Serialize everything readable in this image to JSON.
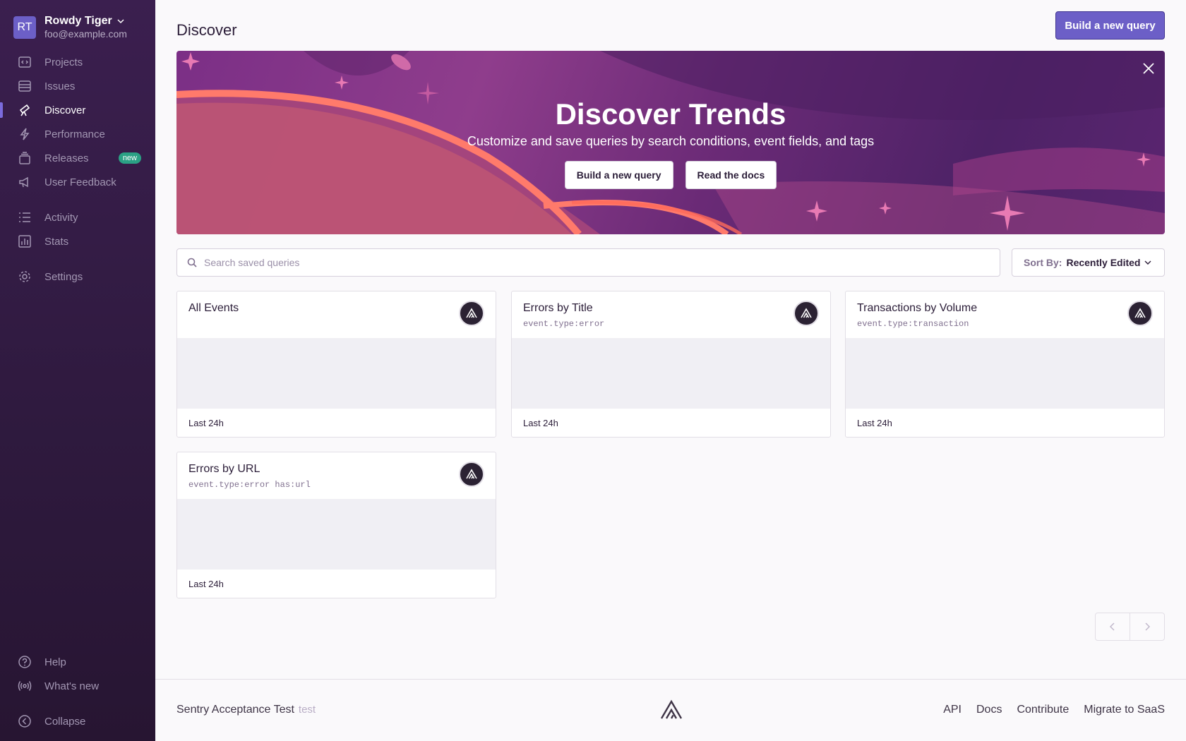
{
  "org": {
    "initials": "RT",
    "name": "Rowdy Tiger",
    "email": "foo@example.com"
  },
  "nav": {
    "projects": "Projects",
    "issues": "Issues",
    "discover": "Discover",
    "performance": "Performance",
    "releases": "Releases",
    "releases_badge": "new",
    "user_feedback": "User Feedback",
    "activity": "Activity",
    "stats": "Stats",
    "settings": "Settings",
    "help": "Help",
    "whats_new": "What's new",
    "collapse": "Collapse"
  },
  "header": {
    "title": "Discover",
    "build_button": "Build a new query"
  },
  "banner": {
    "title": "Discover Trends",
    "subtitle": "Customize and save queries by search conditions, event fields, and tags",
    "build_button": "Build a new query",
    "docs_button": "Read the docs"
  },
  "search": {
    "placeholder": "Search saved queries",
    "value": ""
  },
  "sort": {
    "label": "Sort By:",
    "value": "Recently Edited"
  },
  "cards": [
    {
      "title": "All Events",
      "query": "",
      "footer": "Last 24h"
    },
    {
      "title": "Errors by Title",
      "query": "event.type:error",
      "footer": "Last 24h"
    },
    {
      "title": "Transactions by Volume",
      "query": "event.type:transaction",
      "footer": "Last 24h"
    },
    {
      "title": "Errors by URL",
      "query": "event.type:error has:url",
      "footer": "Last 24h"
    }
  ],
  "footer": {
    "name": "Sentry Acceptance Test",
    "tag": "test",
    "links": {
      "api": "API",
      "docs": "Docs",
      "contribute": "Contribute",
      "migrate": "Migrate to SaaS"
    }
  },
  "colors": {
    "accent": "#6c5fc7",
    "sidebar": "#2f1a3f",
    "badge_green": "#2ba185"
  }
}
